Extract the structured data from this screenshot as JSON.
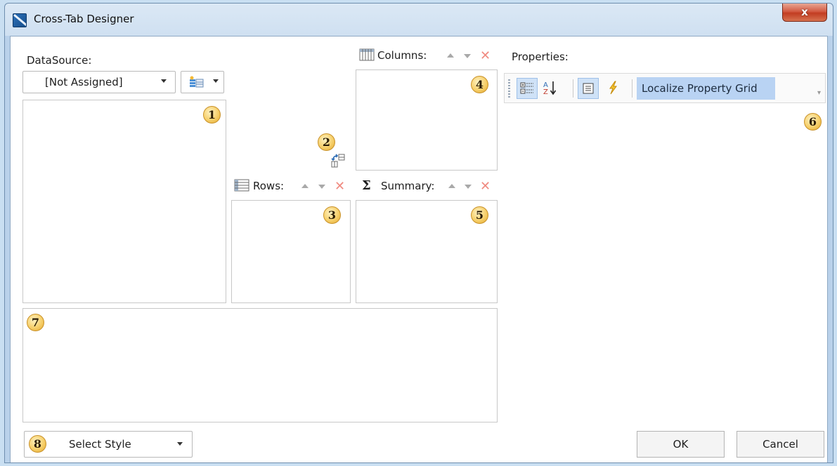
{
  "window": {
    "title": "Cross-Tab Designer",
    "close_label": "x"
  },
  "datasource": {
    "label": "DataSource:",
    "selected": "[Not Assigned]"
  },
  "columns": {
    "label": "Columns:"
  },
  "rows": {
    "label": "Rows:"
  },
  "summary": {
    "label": "Summary:"
  },
  "properties": {
    "label": "Properties:",
    "toolbar_text": "Localize Property Grid",
    "toolbar_buttons": [
      "categorized-icon",
      "sort-alphabetical-icon",
      "property-pages-icon",
      "events-icon"
    ]
  },
  "style": {
    "selected": "Select Style"
  },
  "buttons": {
    "ok": "OK",
    "cancel": "Cancel"
  },
  "badges": [
    "1",
    "2",
    "3",
    "4",
    "5",
    "6",
    "7",
    "8"
  ],
  "colors": {
    "badge": "#f6cf6a",
    "remove": "#f08a80",
    "selection": "#b9d3f3",
    "close": "#c23d22"
  }
}
